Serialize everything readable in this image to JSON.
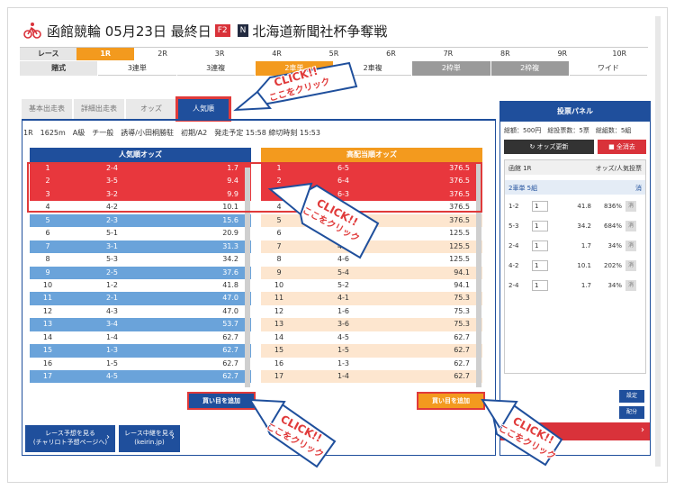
{
  "header": {
    "title_prefix": "函館競輪 05月23日 最終日",
    "badge_f2": "F2",
    "badge_n": "N",
    "title_suffix": "北海道新聞社杯争奪戦"
  },
  "race_row": {
    "label": "レース",
    "races": [
      "1R",
      "2R",
      "3R",
      "4R",
      "5R",
      "6R",
      "7R",
      "8R",
      "9R",
      "10R"
    ],
    "selected_index": 0
  },
  "bet_row": {
    "label": "賭式",
    "types": [
      "3連単",
      "3連複",
      "2車単",
      "2車複",
      "2枠単",
      "2枠複",
      "ワイド"
    ]
  },
  "tabs": [
    "基本出走表",
    "詳細出走表",
    "オッズ",
    "人気順"
  ],
  "active_tab": "人気順",
  "race_info": "1R　1625m　A級　チ一般　誘導/小田桐勝駐　初期/A2　発走予定 15:58 締切時刻 15:53",
  "popular_table": {
    "title": "人気順オッズ",
    "rows": [
      [
        "1",
        "2-4",
        "1.7"
      ],
      [
        "2",
        "3-5",
        "9.4"
      ],
      [
        "3",
        "3-2",
        "9.9"
      ],
      [
        "4",
        "4-2",
        "10.1"
      ],
      [
        "5",
        "2-3",
        "15.6"
      ],
      [
        "6",
        "5-1",
        "20.9"
      ],
      [
        "7",
        "3-1",
        "31.3"
      ],
      [
        "8",
        "5-3",
        "34.2"
      ],
      [
        "9",
        "2-5",
        "37.6"
      ],
      [
        "10",
        "1-2",
        "41.8"
      ],
      [
        "11",
        "2-1",
        "47.0"
      ],
      [
        "12",
        "4-3",
        "47.0"
      ],
      [
        "13",
        "3-4",
        "53.7"
      ],
      [
        "14",
        "1-4",
        "62.7"
      ],
      [
        "15",
        "1-3",
        "62.7"
      ],
      [
        "16",
        "1-5",
        "62.7"
      ],
      [
        "17",
        "4-5",
        "62.7"
      ]
    ]
  },
  "high_table": {
    "title": "高配当順オッズ",
    "rows": [
      [
        "1",
        "6-5",
        "376.5"
      ],
      [
        "2",
        "6-4",
        "376.5"
      ],
      [
        "3",
        "6-3",
        "376.5"
      ],
      [
        "4",
        "6-2",
        "376.5"
      ],
      [
        "5",
        "6-1",
        "376.5"
      ],
      [
        "6",
        "5-6",
        "125.5"
      ],
      [
        "7",
        "4-6",
        "125.5"
      ],
      [
        "8",
        "4-6",
        "125.5"
      ],
      [
        "9",
        "5-4",
        "94.1"
      ],
      [
        "10",
        "5-2",
        "94.1"
      ],
      [
        "11",
        "4-1",
        "75.3"
      ],
      [
        "12",
        "1-6",
        "75.3"
      ],
      [
        "13",
        "3-6",
        "75.3"
      ],
      [
        "14",
        "4-5",
        "62.7"
      ],
      [
        "15",
        "1-5",
        "62.7"
      ],
      [
        "16",
        "1-3",
        "62.7"
      ],
      [
        "17",
        "1-4",
        "62.7"
      ]
    ]
  },
  "add_button_label": "買い目を追加",
  "nav_buttons": [
    {
      "line1": "レース予想を見る",
      "line2": "(チャリロト予想ページへ)"
    },
    {
      "line1": "レース中継を見る",
      "line2": "(keirin.jp)"
    }
  ],
  "bet_panel": {
    "title": "投票パネル",
    "summary": "総額：500円　総投票数：5票　総組数：5組",
    "update_label": "オッズ更新",
    "delete_all_label": "全消去",
    "race_label": "函館 1R",
    "sort_label": "オッズ/人気投票",
    "kind_label": "2車単 5組",
    "delete_label": "消",
    "rows": [
      [
        "1-2",
        "1",
        "41.8",
        "836%"
      ],
      [
        "5-3",
        "1",
        "34.2",
        "684%"
      ],
      [
        "2-4",
        "1",
        "1.7",
        "34%"
      ],
      [
        "4-2",
        "1",
        "10.1",
        "202%"
      ],
      [
        "2-4",
        "1",
        "1.7",
        "34%"
      ]
    ],
    "set_label": "設定",
    "split_label": "配分"
  },
  "callouts": {
    "click": "CLICK!!",
    "tap": "ここをクリック"
  },
  "colors": {
    "blue": "#1f4f9c",
    "light_blue": "#6aa3da",
    "orange": "#f39a1e",
    "red": "#e03a3a"
  }
}
